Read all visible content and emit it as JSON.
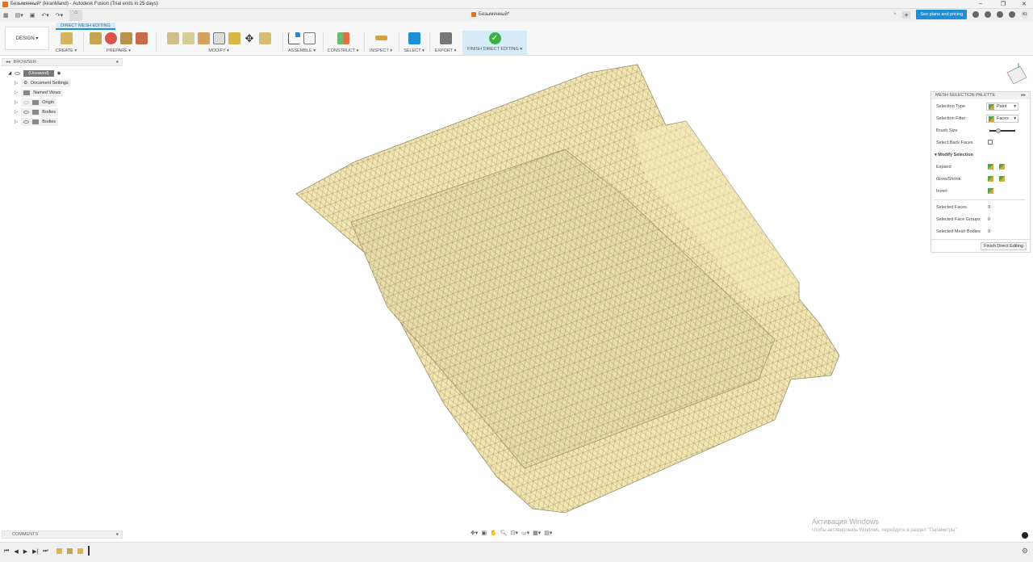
{
  "window": {
    "title": "Безымянный* (kiranMand) - Autodesk Fusion (Trial ends in 25 days)",
    "minimize": "–",
    "maximize": "❐",
    "close": "✕"
  },
  "quick_access": {
    "grid": "▦",
    "file": "▤▾",
    "save": "▣",
    "undo": "↶▾",
    "redo": "↷▾",
    "home": "⌂"
  },
  "doc_tab": {
    "name": "Безымянный*",
    "close": "×",
    "add": "+"
  },
  "header": {
    "plans_button": "See plans and pricing",
    "user_initials": "KI"
  },
  "workspace": {
    "label": "DESIGN ▾",
    "active_tab": "DIRECT MESH EDITING"
  },
  "toolbar": {
    "groups": [
      {
        "label": "CREATE ▾",
        "icons": [
          "create-mesh-icon"
        ]
      },
      {
        "label": "PREPARE ▾",
        "icons": [
          "prepare-1-icon",
          "prepare-2-icon",
          "prepare-3-icon",
          "prepare-4-icon"
        ]
      },
      {
        "label": "MODIFY ▾",
        "icons": [
          "plane-cut-icon",
          "separate-icon",
          "reduce-icon",
          "shell-icon",
          "combine-icon",
          "move-icon",
          "scale-icon"
        ]
      },
      {
        "label": "ASSEMBLE ▾",
        "icons": [
          "joint-icon",
          "table-icon"
        ]
      },
      {
        "label": "CONSTRUCT ▾",
        "icons": [
          "plane-icon"
        ]
      },
      {
        "label": "INSPECT ▾",
        "icons": [
          "measure-icon"
        ]
      },
      {
        "label": "SELECT ▾",
        "icons": [
          "select-icon"
        ]
      },
      {
        "label": "EXPORT ▾",
        "icons": [
          "export-icon"
        ]
      }
    ],
    "finish": "FINISH DIRECT EDITING ▾"
  },
  "browser": {
    "title": "BROWSER",
    "items": [
      {
        "label": "(Unsaved)"
      },
      {
        "label": "Document Settings"
      },
      {
        "label": "Named Views"
      },
      {
        "label": "Origin"
      },
      {
        "label": "Bodies"
      },
      {
        "label": "Bodies"
      }
    ]
  },
  "palette": {
    "title": "MESH SELECTION PALETTE",
    "selection_type_label": "Selection Type",
    "selection_type": "Paint",
    "selection_filter_label": "Selection Filter",
    "selection_filter": "Faces",
    "brush_size_label": "Brush Size",
    "brush_size": 0.25,
    "back_faces_label": "Select Back Faces",
    "modify_section": "Modify Selection",
    "expand": "Expand",
    "grow_shrink": "Grow/Shrink",
    "invert": "Invert",
    "selected_faces_label": "Selected Faces",
    "selected_faces": "0",
    "selected_groups_label": "Selected Face Groups",
    "selected_groups": "0",
    "selected_bodies_label": "Selected Mesh Bodies",
    "selected_bodies": "0",
    "finish_button": "Finish Direct Editing"
  },
  "comments": {
    "title": "COMMENTS"
  },
  "watermark": {
    "line1": "Активация Windows",
    "line2": "Чтобы активировать Windows, перейдите в раздел \"Параметры\"."
  },
  "nav": {
    "orbit": "✥▾",
    "look": "▣",
    "pan": "✋",
    "zoom": "🔍︎",
    "fit": "⊡▾",
    "display": "▭▾",
    "grid": "▦▾",
    "viewports": "▤▾"
  },
  "timeline": {
    "first": "⏮",
    "prev": "◀",
    "play": "▶",
    "next": "▶|",
    "last": "⏭",
    "settings": "⚙"
  },
  "colors": {
    "accent": "#1d8fd6",
    "mesh": "#f3e6b0",
    "mesh_line": "#8b8462"
  }
}
